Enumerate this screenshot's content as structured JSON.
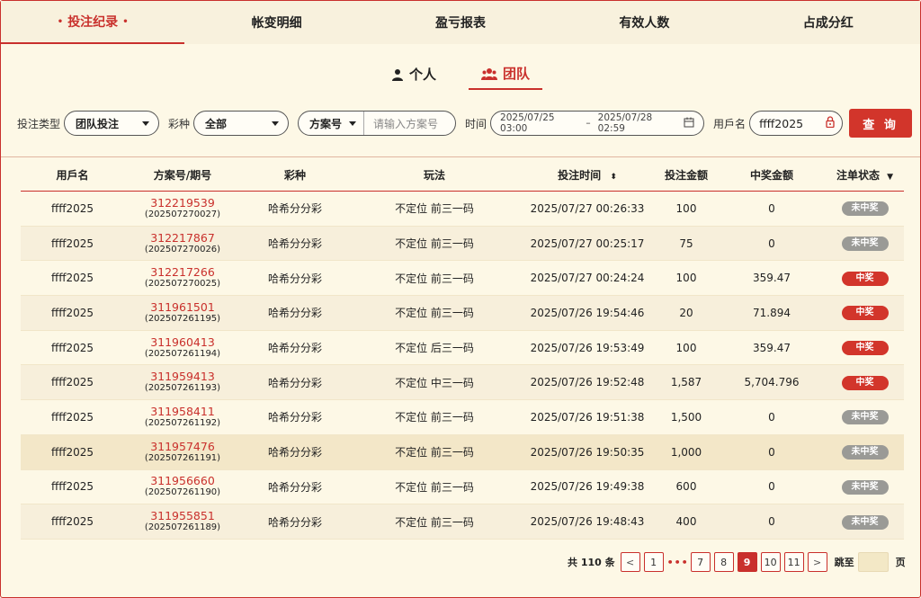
{
  "tabs": [
    {
      "label": "投注纪录",
      "active": true
    },
    {
      "label": "帐变明细",
      "active": false
    },
    {
      "label": "盈亏报表",
      "active": false
    },
    {
      "label": "有效人数",
      "active": false
    },
    {
      "label": "占成分红",
      "active": false
    }
  ],
  "scope": {
    "personal": "个人",
    "team": "团队",
    "active": "team"
  },
  "filters": {
    "bet_type_label": "投注类型",
    "bet_type_value": "团队投注",
    "lottery_label": "彩种",
    "lottery_value": "全部",
    "plan_select": "方案号",
    "plan_placeholder": "请输入方案号",
    "time_label": "时间",
    "time_start": "2025/07/25 03:00",
    "time_sep": "–",
    "time_end": "2025/07/28 02:59",
    "user_label": "用戶名",
    "user_value": "ffff2025",
    "query_button": "查 询"
  },
  "table": {
    "headers": [
      "用戶名",
      "方案号/期号",
      "彩种",
      "玩法",
      "投注时间",
      "投注金额",
      "中奖金额",
      "注单状态"
    ],
    "rows": [
      {
        "user": "ffff2025",
        "plan": "312219539",
        "issue": "(202507270027)",
        "lottery": "哈希分分彩",
        "play": "不定位 前三一码",
        "time": "2025/07/27 00:26:33",
        "bet": "100",
        "win": "0",
        "status": "未中奖",
        "won": false
      },
      {
        "user": "ffff2025",
        "plan": "312217867",
        "issue": "(202507270026)",
        "lottery": "哈希分分彩",
        "play": "不定位 前三一码",
        "time": "2025/07/27 00:25:17",
        "bet": "75",
        "win": "0",
        "status": "未中奖",
        "won": false
      },
      {
        "user": "ffff2025",
        "plan": "312217266",
        "issue": "(202507270025)",
        "lottery": "哈希分分彩",
        "play": "不定位 前三一码",
        "time": "2025/07/27 00:24:24",
        "bet": "100",
        "win": "359.47",
        "status": "中奖",
        "won": true
      },
      {
        "user": "ffff2025",
        "plan": "311961501",
        "issue": "(202507261195)",
        "lottery": "哈希分分彩",
        "play": "不定位 前三一码",
        "time": "2025/07/26 19:54:46",
        "bet": "20",
        "win": "71.894",
        "status": "中奖",
        "won": true
      },
      {
        "user": "ffff2025",
        "plan": "311960413",
        "issue": "(202507261194)",
        "lottery": "哈希分分彩",
        "play": "不定位 后三一码",
        "time": "2025/07/26 19:53:49",
        "bet": "100",
        "win": "359.47",
        "status": "中奖",
        "won": true
      },
      {
        "user": "ffff2025",
        "plan": "311959413",
        "issue": "(202507261193)",
        "lottery": "哈希分分彩",
        "play": "不定位 中三一码",
        "time": "2025/07/26 19:52:48",
        "bet": "1,587",
        "win": "5,704.796",
        "status": "中奖",
        "won": true
      },
      {
        "user": "ffff2025",
        "plan": "311958411",
        "issue": "(202507261192)",
        "lottery": "哈希分分彩",
        "play": "不定位 前三一码",
        "time": "2025/07/26 19:51:38",
        "bet": "1,500",
        "win": "0",
        "status": "未中奖",
        "won": false
      },
      {
        "user": "ffff2025",
        "plan": "311957476",
        "issue": "(202507261191)",
        "lottery": "哈希分分彩",
        "play": "不定位 前三一码",
        "time": "2025/07/26 19:50:35",
        "bet": "1,000",
        "win": "0",
        "status": "未中奖",
        "won": false
      },
      {
        "user": "ffff2025",
        "plan": "311956660",
        "issue": "(202507261190)",
        "lottery": "哈希分分彩",
        "play": "不定位 前三一码",
        "time": "2025/07/26 19:49:38",
        "bet": "600",
        "win": "0",
        "status": "未中奖",
        "won": false
      },
      {
        "user": "ffff2025",
        "plan": "311955851",
        "issue": "(202507261189)",
        "lottery": "哈希分分彩",
        "play": "不定位 前三一码",
        "time": "2025/07/26 19:48:43",
        "bet": "400",
        "win": "0",
        "status": "未中奖",
        "won": false
      }
    ]
  },
  "pager": {
    "total": "共 110 条",
    "prev": "<",
    "next": ">",
    "first": "1",
    "ellipsis": "•••",
    "pages": [
      "7",
      "8",
      "9",
      "10",
      "11"
    ],
    "current": "9",
    "jump_label": "跳至",
    "jump_suffix": "页"
  },
  "colors": {
    "accent": "#c9302c",
    "background": "#fdf8e6",
    "lost_badge": "#9a9a96",
    "won_badge": "#d2352b"
  }
}
